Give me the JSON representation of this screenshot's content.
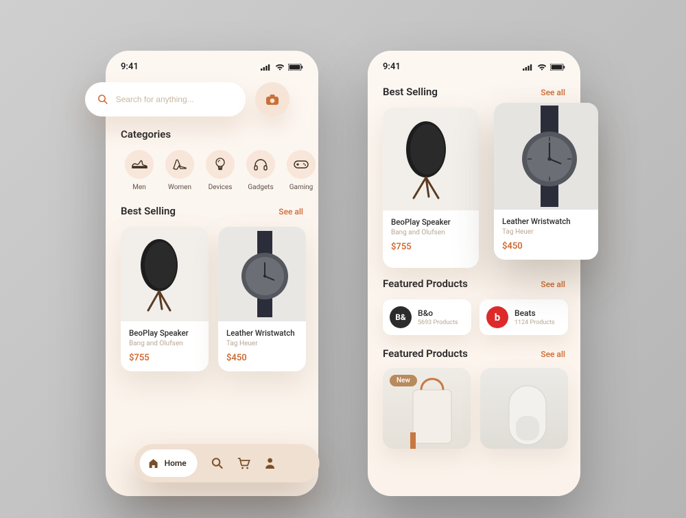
{
  "status": {
    "time": "9:41"
  },
  "search": {
    "placeholder": "Search for anything..."
  },
  "categories": {
    "title": "Categories",
    "items": [
      {
        "label": "Men"
      },
      {
        "label": "Women"
      },
      {
        "label": "Devices"
      },
      {
        "label": "Gadgets"
      },
      {
        "label": "Gaming"
      }
    ]
  },
  "best_selling": {
    "title": "Best Selling",
    "see_all": "See all",
    "items": [
      {
        "name": "BeoPlay Speaker",
        "brand": "Bang and Olufsen",
        "price": "$755"
      },
      {
        "name": "Leather Wristwatch",
        "brand": "Tag Heuer",
        "price": "$450"
      }
    ]
  },
  "featured_brands": {
    "title": "Featured Products",
    "see_all": "See all",
    "items": [
      {
        "name": "B&o",
        "count": "5693 Products"
      },
      {
        "name": "Beats",
        "count": "1124 Products"
      }
    ]
  },
  "featured_products": {
    "title": "Featured Products",
    "see_all": "See all",
    "new_badge": "New"
  },
  "nav": {
    "home": "Home"
  }
}
